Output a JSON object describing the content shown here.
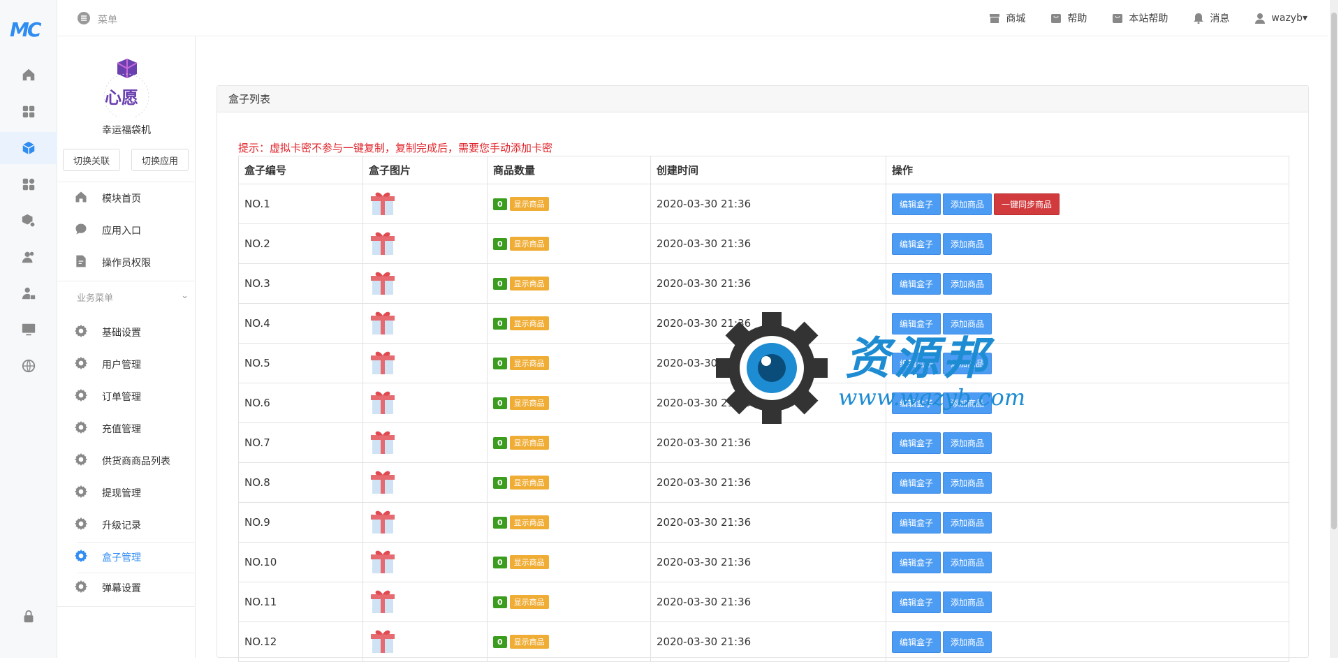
{
  "rail": {
    "logo": "MC",
    "icons": [
      "home-icon",
      "grid-icon",
      "cube-icon",
      "apps-icon",
      "box-gear-icon",
      "users-icon",
      "user-lock-icon",
      "monitor-icon",
      "globe-icon",
      "lock-icon"
    ]
  },
  "topbar": {
    "menu_label": "菜单",
    "links": [
      {
        "label": "商城",
        "icon": "store-icon"
      },
      {
        "label": "帮助",
        "icon": "bag-icon"
      },
      {
        "label": "本站帮助",
        "icon": "bag-icon"
      },
      {
        "label": "消息",
        "icon": "bell-icon"
      },
      {
        "label": "wazyb▾",
        "icon": "user-icon"
      }
    ]
  },
  "sidebar": {
    "app_name": "幸运福袋机",
    "logo_text": "心愿",
    "switch_link": "切换关联",
    "switch_app": "切换应用",
    "top_items": [
      {
        "label": "模块首页"
      },
      {
        "label": "应用入口"
      },
      {
        "label": "操作员权限"
      }
    ],
    "section_title": "业务菜单",
    "items": [
      {
        "label": "基础设置"
      },
      {
        "label": "用户管理"
      },
      {
        "label": "订单管理"
      },
      {
        "label": "充值管理"
      },
      {
        "label": "供货商商品列表"
      },
      {
        "label": "提现管理"
      },
      {
        "label": "升级记录"
      },
      {
        "label": "盒子管理"
      },
      {
        "label": "弹幕设置"
      }
    ]
  },
  "panel": {
    "title": "盒子列表",
    "tip": "提示：虚拟卡密不参与一键复制，复制完成后，需要您手动添加卡密",
    "headers": [
      "盒子编号",
      "盒子图片",
      "商品数量",
      "创建时间",
      "操作"
    ],
    "count_badge": "0",
    "show_badge": "显示商品",
    "edit_btn": "编辑盒子",
    "add_btn": "添加商品",
    "sync_btn": "一键同步商品",
    "rows": [
      {
        "no": "NO.1",
        "time": "2020-03-30 21:36"
      },
      {
        "no": "NO.2",
        "time": "2020-03-30 21:36"
      },
      {
        "no": "NO.3",
        "time": "2020-03-30 21:36"
      },
      {
        "no": "NO.4",
        "time": "2020-03-30 21:36"
      },
      {
        "no": "NO.5",
        "time": "2020-03-30 21:36"
      },
      {
        "no": "NO.6",
        "time": "2020-03-30 21:36"
      },
      {
        "no": "NO.7",
        "time": "2020-03-30 21:36"
      },
      {
        "no": "NO.8",
        "time": "2020-03-30 21:36"
      },
      {
        "no": "NO.9",
        "time": "2020-03-30 21:36"
      },
      {
        "no": "NO.10",
        "time": "2020-03-30 21:36"
      },
      {
        "no": "NO.11",
        "time": "2020-03-30 21:36"
      },
      {
        "no": "NO.12",
        "time": "2020-03-30 21:36"
      }
    ]
  },
  "watermark": {
    "title": "资源邦",
    "url": "www.wazyb.com"
  }
}
